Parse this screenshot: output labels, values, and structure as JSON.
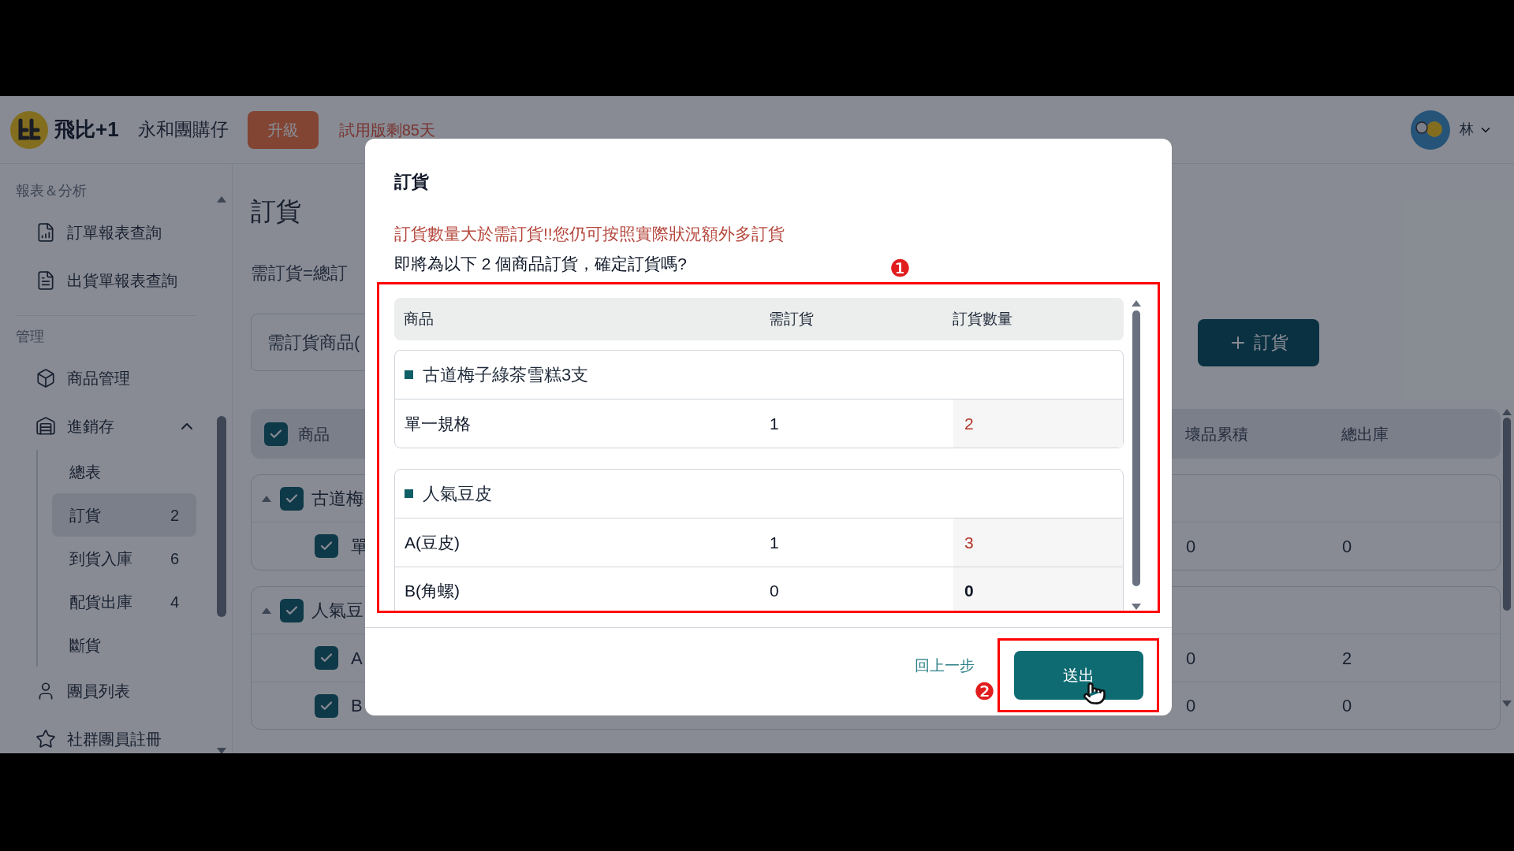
{
  "header": {
    "brand": "飛比+1",
    "store": "永和團購仔",
    "upgrade_button": "升級",
    "trial_notice": "試用版剩85天",
    "user": "林"
  },
  "sidebar": {
    "sections": [
      {
        "title": "報表＆分析",
        "items": [
          {
            "label": "訂單報表查詢",
            "kind": "report"
          },
          {
            "label": "出貨單報表查詢",
            "kind": "invoice"
          }
        ]
      },
      {
        "title": "管理",
        "items": [
          {
            "label": "商品管理",
            "kind": "product"
          },
          {
            "label": "進銷存",
            "kind": "inventory",
            "expanded": true,
            "children": [
              {
                "label": "總表",
                "selected": false
              },
              {
                "label": "訂貨",
                "count": "2",
                "selected": true
              },
              {
                "label": "到貨入庫",
                "count": "6",
                "selected": false
              },
              {
                "label": "配貨出庫",
                "count": "4",
                "selected": false
              },
              {
                "label": "斷貨",
                "selected": false
              }
            ]
          },
          {
            "label": "團員列表",
            "kind": "member"
          },
          {
            "label": "社群團員註冊",
            "kind": "star"
          }
        ]
      }
    ]
  },
  "page": {
    "title": "訂貨",
    "formula": "需訂貨=總訂",
    "filter": "需訂貨商品(",
    "add_button": "訂貨",
    "table": {
      "header_checked": true,
      "columns": [
        "商品",
        "壞品累積",
        "總出庫"
      ],
      "groups": [
        {
          "name": "古道梅",
          "checked": true,
          "expanded": true,
          "rows": [
            {
              "name": "單",
              "checked": true,
              "values": [
                "0",
                "0"
              ]
            }
          ]
        },
        {
          "name": "人氣豆",
          "checked": true,
          "expanded": true,
          "rows": [
            {
              "name": "A",
              "checked": true,
              "values": [
                "0",
                "2"
              ]
            },
            {
              "name": "B",
              "checked": true,
              "values": [
                "0",
                "0"
              ]
            }
          ]
        }
      ]
    }
  },
  "modal": {
    "title": "訂貨",
    "warning": "訂貨數量大於需訂貨!!您仍可按照實際狀況額外多訂貨",
    "question": "即將為以下 2 個商品訂貨，確定訂貨嗎?",
    "columns": [
      "商品",
      "需訂貨",
      "訂貨數量"
    ],
    "groups": [
      {
        "name": "古道梅子綠茶雪糕3支",
        "variants": [
          {
            "name": "單一規格",
            "need": "1",
            "qty": "2",
            "over": true
          }
        ]
      },
      {
        "name": "人氣豆皮",
        "variants": [
          {
            "name": "A(豆皮)",
            "need": "1",
            "qty": "3",
            "over": true
          },
          {
            "name": "B(角螺)",
            "need": "0",
            "qty": "0",
            "over": false
          }
        ]
      }
    ],
    "back_link": "回上一步",
    "submit_button": "送出"
  },
  "annotations": [
    {
      "label": "❶"
    },
    {
      "label": "❷"
    }
  ]
}
